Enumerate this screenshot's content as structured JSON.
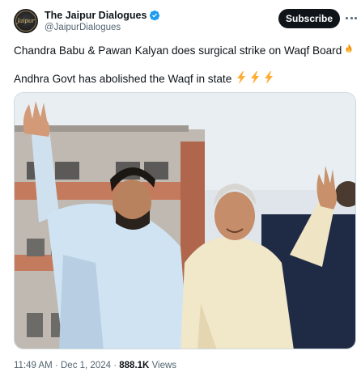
{
  "author": {
    "display_name": "The Jaipur Dialogues",
    "handle": "@JaipurDialogues",
    "avatar_mark": "Jaipur",
    "verified_icon": "verified-badge-icon"
  },
  "actions": {
    "subscribe_label": "Subscribe",
    "more_icon": "more-dots-icon"
  },
  "post": {
    "line1": "Chandra Babu & Pawan Kalyan does surgical strike on Waqf Board",
    "line1_emoji": "fire-emoji",
    "line2": "Andhra Govt has abolished the Waqf in state",
    "line2_emojis": [
      "lightning-emoji",
      "lightning-emoji",
      "lightning-emoji"
    ]
  },
  "media": {
    "alt": "photo"
  },
  "meta": {
    "time": "11:49 AM",
    "separator": "·",
    "date": "Dec 1, 2024",
    "views_count": "888.1K",
    "views_label": "Views"
  },
  "colors": {
    "text_primary": "#0f1419",
    "text_secondary": "#536471",
    "verified_blue": "#1d9bf0",
    "button_bg": "#0f1419"
  }
}
